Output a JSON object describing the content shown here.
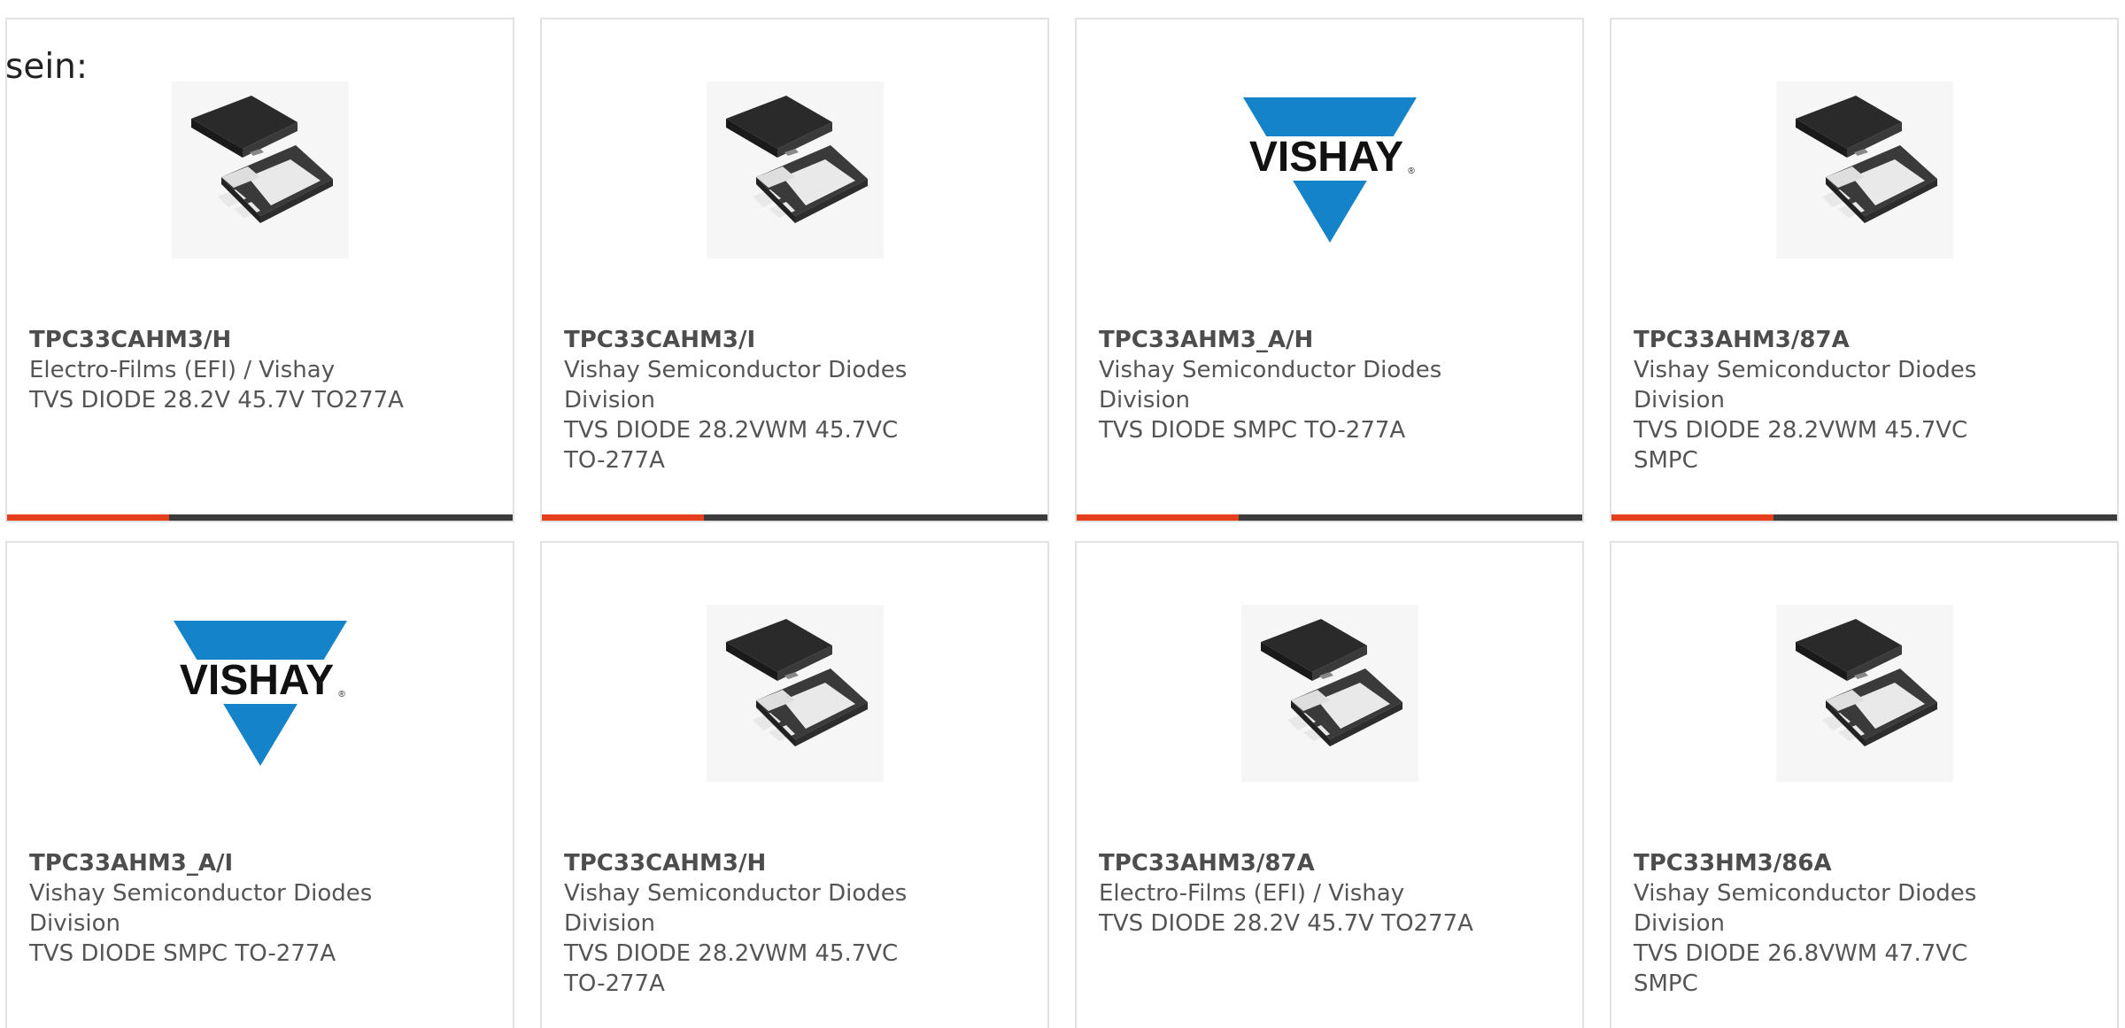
{
  "intro_text": "sein:",
  "colors": {
    "accent": "#e5401d",
    "bar": "#3b3b3b",
    "vishay_blue": "#1583c9"
  },
  "products": [
    {
      "part": "TPC33CAHM3/H",
      "manufacturer": "Electro-Films (EFI) / Vishay",
      "description": "TVS DIODE 28.2V 45.7V TO277A",
      "image": "smpc-package-photo"
    },
    {
      "part": "TPC33CAHM3/I",
      "manufacturer": "Vishay Semiconductor Diodes Division",
      "description": "TVS DIODE 28.2VWM 45.7VC TO-277A",
      "image": "smpc-package-photo"
    },
    {
      "part": "TPC33AHM3_A/H",
      "manufacturer": "Vishay Semiconductor Diodes Division",
      "description": "TVS DIODE SMPC TO-277A",
      "image": "vishay-logo",
      "logo_text": "VISHAY"
    },
    {
      "part": "TPC33AHM3/87A",
      "manufacturer": "Vishay Semiconductor Diodes Division",
      "description": "TVS DIODE 28.2VWM 45.7VC SMPC",
      "image": "smpc-package-photo"
    },
    {
      "part": "TPC33AHM3_A/I",
      "manufacturer": "Vishay Semiconductor Diodes Division",
      "description": "TVS DIODE SMPC TO-277A",
      "image": "vishay-logo",
      "logo_text": "VISHAY"
    },
    {
      "part": "TPC33CAHM3/H",
      "manufacturer": "Vishay Semiconductor Diodes Division",
      "description": "TVS DIODE 28.2VWM 45.7VC TO-277A",
      "image": "smpc-package-photo"
    },
    {
      "part": "TPC33AHM3/87A",
      "manufacturer": "Electro-Films (EFI) / Vishay",
      "description": "TVS DIODE 28.2V 45.7V TO277A",
      "image": "smpc-package-photo"
    },
    {
      "part": "TPC33HM3/86A",
      "manufacturer": "Vishay Semiconductor Diodes Division",
      "description": "TVS DIODE 26.8VWM 47.7VC SMPC",
      "image": "smpc-package-photo"
    }
  ]
}
